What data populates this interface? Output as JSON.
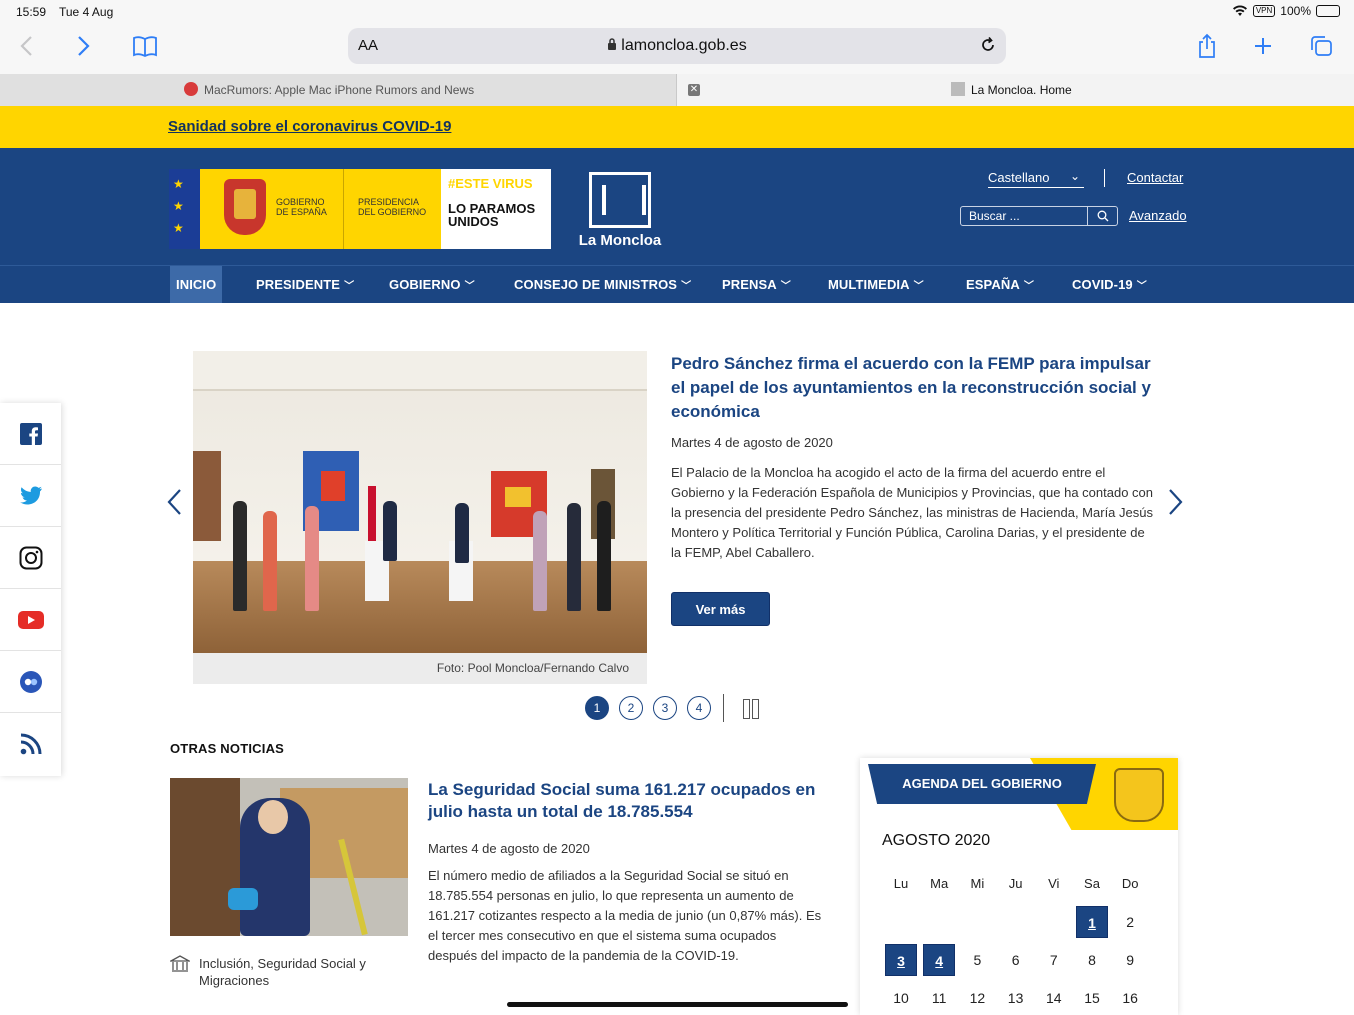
{
  "status_bar": {
    "time": "15:59",
    "date": "Tue 4 Aug",
    "vpn": "VPN",
    "battery": "100%"
  },
  "browser": {
    "aa_label": "AA",
    "url": "lamoncloa.gob.es",
    "tabs": [
      {
        "label": "MacRumors: Apple Mac iPhone Rumors and News"
      },
      {
        "label": "La Moncloa. Home"
      }
    ],
    "close_label": "✕"
  },
  "banner": {
    "link": "Sanidad sobre el coronavirus COVID-19"
  },
  "header": {
    "gov_line1": "GOBIERNO",
    "gov_line2": "DE ESPAÑA",
    "pres_line1": "PRESIDENCIA",
    "pres_line2": "DEL GOBIERNO",
    "virus_line1": "#ESTE VIRUS",
    "virus_line2": "LO PARAMOS UNIDOS",
    "site_name": "La Moncloa",
    "language": "Castellano",
    "contact": "Contactar",
    "search_placeholder": "Buscar ...",
    "advanced": "Avanzado"
  },
  "nav": [
    {
      "label": "INICIO"
    },
    {
      "label": "PRESIDENTE"
    },
    {
      "label": "GOBIERNO"
    },
    {
      "label": "CONSEJO DE MINISTROS"
    },
    {
      "label": "PRENSA"
    },
    {
      "label": "MULTIMEDIA"
    },
    {
      "label": "ESPAÑA"
    },
    {
      "label": "COVID-19"
    }
  ],
  "social": [
    "facebook-icon",
    "twitter-icon",
    "instagram-icon",
    "youtube-icon",
    "flickr-icon",
    "rss-icon"
  ],
  "featured": {
    "title": "Pedro Sánchez firma el acuerdo con la FEMP para impulsar el papel de los ayuntamientos en la reconstrucción social y económica",
    "date": "Martes 4 de agosto de 2020",
    "body": "El Palacio de la Moncloa ha acogido el acto de la firma del acuerdo entre el Gobierno y la Federación Española de Municipios y Provincias, que ha contado con la presencia del presidente Pedro Sánchez, las ministras de Hacienda, María Jesús Montero y Política Territorial y Función Pública, Carolina Darias, y el presidente de la FEMP, Abel Caballero.",
    "more": "Ver más",
    "caption": "Foto: Pool Moncloa/Fernando Calvo",
    "pages": [
      "1",
      "2",
      "3",
      "4"
    ],
    "active_page": "1"
  },
  "other_news": {
    "section_title": "OTRAS NOTICIAS",
    "title": "La Seguridad Social suma 161.217 ocupados en julio hasta un total de 18.785.554",
    "date": "Martes 4 de agosto de 2020",
    "body": "El número medio de afiliados a la Seguridad Social se situó en 18.785.554 personas en julio, lo que representa un aumento de 161.217 cotizantes respecto a la media de junio (un 0,87% más). Es el tercer mes consecutivo en que el sistema suma ocupados después del impacto de la pandemia de la COVID-19.",
    "ministry": "Inclusión, Seguridad Social y Migraciones"
  },
  "agenda": {
    "title": "AGENDA DEL GOBIERNO",
    "month": "AGOSTO 2020",
    "weekdays": [
      "Lu",
      "Ma",
      "Mi",
      "Ju",
      "Vi",
      "Sa",
      "Do"
    ],
    "rows": [
      [
        "",
        "",
        "",
        "",
        "",
        "1",
        "2"
      ],
      [
        "3",
        "4",
        "5",
        "6",
        "7",
        "8",
        "9"
      ],
      [
        "10",
        "11",
        "12",
        "13",
        "14",
        "15",
        "16"
      ]
    ],
    "event_days": [
      "1",
      "3",
      "4"
    ]
  },
  "colors": {
    "primary": "#1b4582",
    "accent": "#ffd500"
  }
}
